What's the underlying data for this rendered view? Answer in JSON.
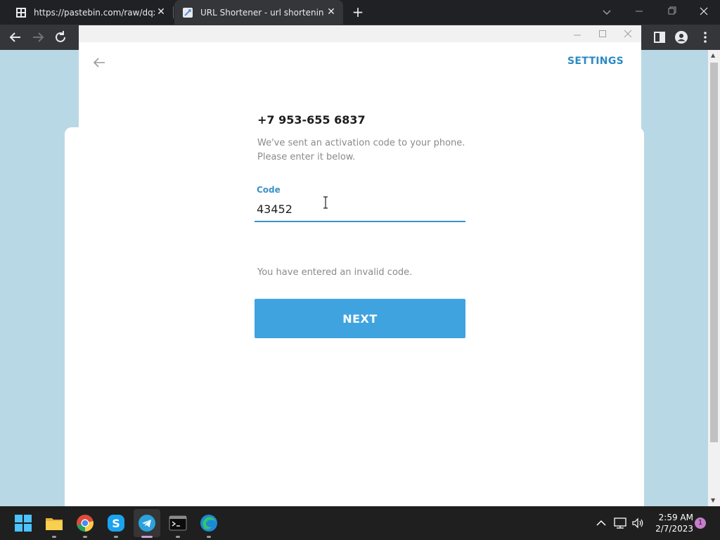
{
  "browser": {
    "tabs": [
      {
        "title": "https://pastebin.com/raw/dqxax\\",
        "favicon": "pastebin-icon",
        "active": false
      },
      {
        "title": "URL Shortener - url shortening se",
        "favicon": "url-shortener-icon",
        "active": true
      }
    ],
    "new_tab_symbol": "+",
    "close_symbol": "✕"
  },
  "telegram": {
    "settings_label": "SETTINGS",
    "phone_number": "+7 953-655 6837",
    "description_line1": "We've sent an activation code to your phone.",
    "description_line2": "Please enter it below.",
    "code_label": "Code",
    "code_value": "43452",
    "error_message": "You have entered an invalid code.",
    "next_button_label": "NEXT",
    "accent_color": "#3fa3e0"
  },
  "taskbar": {
    "apps": [
      "start-icon",
      "file-explorer-icon",
      "chrome-icon",
      "skype-icon",
      "telegram-icon",
      "terminal-icon",
      "edge-icon"
    ],
    "active_app": "telegram-icon",
    "tray": [
      "chevron-up-icon",
      "network-icon",
      "volume-icon"
    ],
    "time": "2:59 AM",
    "date": "2/7/2023",
    "notification_count": "1"
  }
}
